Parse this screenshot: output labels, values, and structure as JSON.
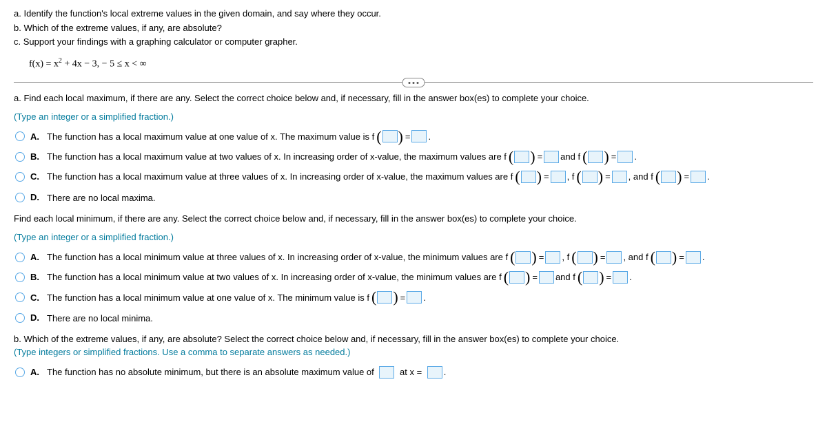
{
  "header": {
    "a": "a. Identify the function's local extreme values in the given domain, and say where they occur.",
    "b": "b. Which of the extreme values, if any, are absolute?",
    "c": "c. Support your findings with a graphing calculator or computer grapher."
  },
  "formula": {
    "lhs": "f(x) = x",
    "exp": "2",
    "rhs": " + 4x − 3,  − 5 ≤ x < ∞"
  },
  "partA": {
    "prompt": "a. Find each local maximum, if there are any. Select the correct choice below and, if necessary, fill in the answer box(es) to complete your choice.",
    "instruction": "(Type an integer or a simplified fraction.)",
    "choices": {
      "A_pre": "The function has a local maximum value at one value of x. The maximum value is f",
      "B_pre": "The function has a local maximum value at two values of x. In increasing order of x-value, the maximum values are f",
      "C_pre": "The function has a local maximum value at three values of x. In increasing order of x-value, the maximum values are f",
      "D": "There are no local maxima."
    }
  },
  "partMin": {
    "prompt": "Find each local minimum, if there are any. Select the correct choice below and, if necessary, fill in the answer box(es) to complete your choice.",
    "instruction": "(Type an integer or a simplified fraction.)",
    "choices": {
      "A_pre": "The function has a local minimum value at three values of x. In increasing order of x-value, the minimum values are f",
      "B_pre": "The function has a local minimum value at two values of x. In increasing order of x-value, the minimum values are f",
      "C_pre": "The function has a local minimum value at one value of x. The minimum value is f",
      "D": "There are no local minima."
    }
  },
  "partB": {
    "prompt": "b. Which of the extreme values, if any, are absolute? Select the correct choice below and, if necessary, fill in the answer box(es) to complete your choice.",
    "instruction": "(Type integers or simplified fractions. Use a comma to separate answers as needed.)",
    "A_pre": "The function has no absolute minimum, but there is an absolute maximum value of",
    "A_mid": "at x ="
  },
  "common": {
    "eq": " = ",
    "and_f": " and f",
    "comma_f": ", f",
    "comma_and_f": ", and f",
    "period": "."
  },
  "labels": {
    "A": "A.",
    "B": "B.",
    "C": "C.",
    "D": "D."
  }
}
